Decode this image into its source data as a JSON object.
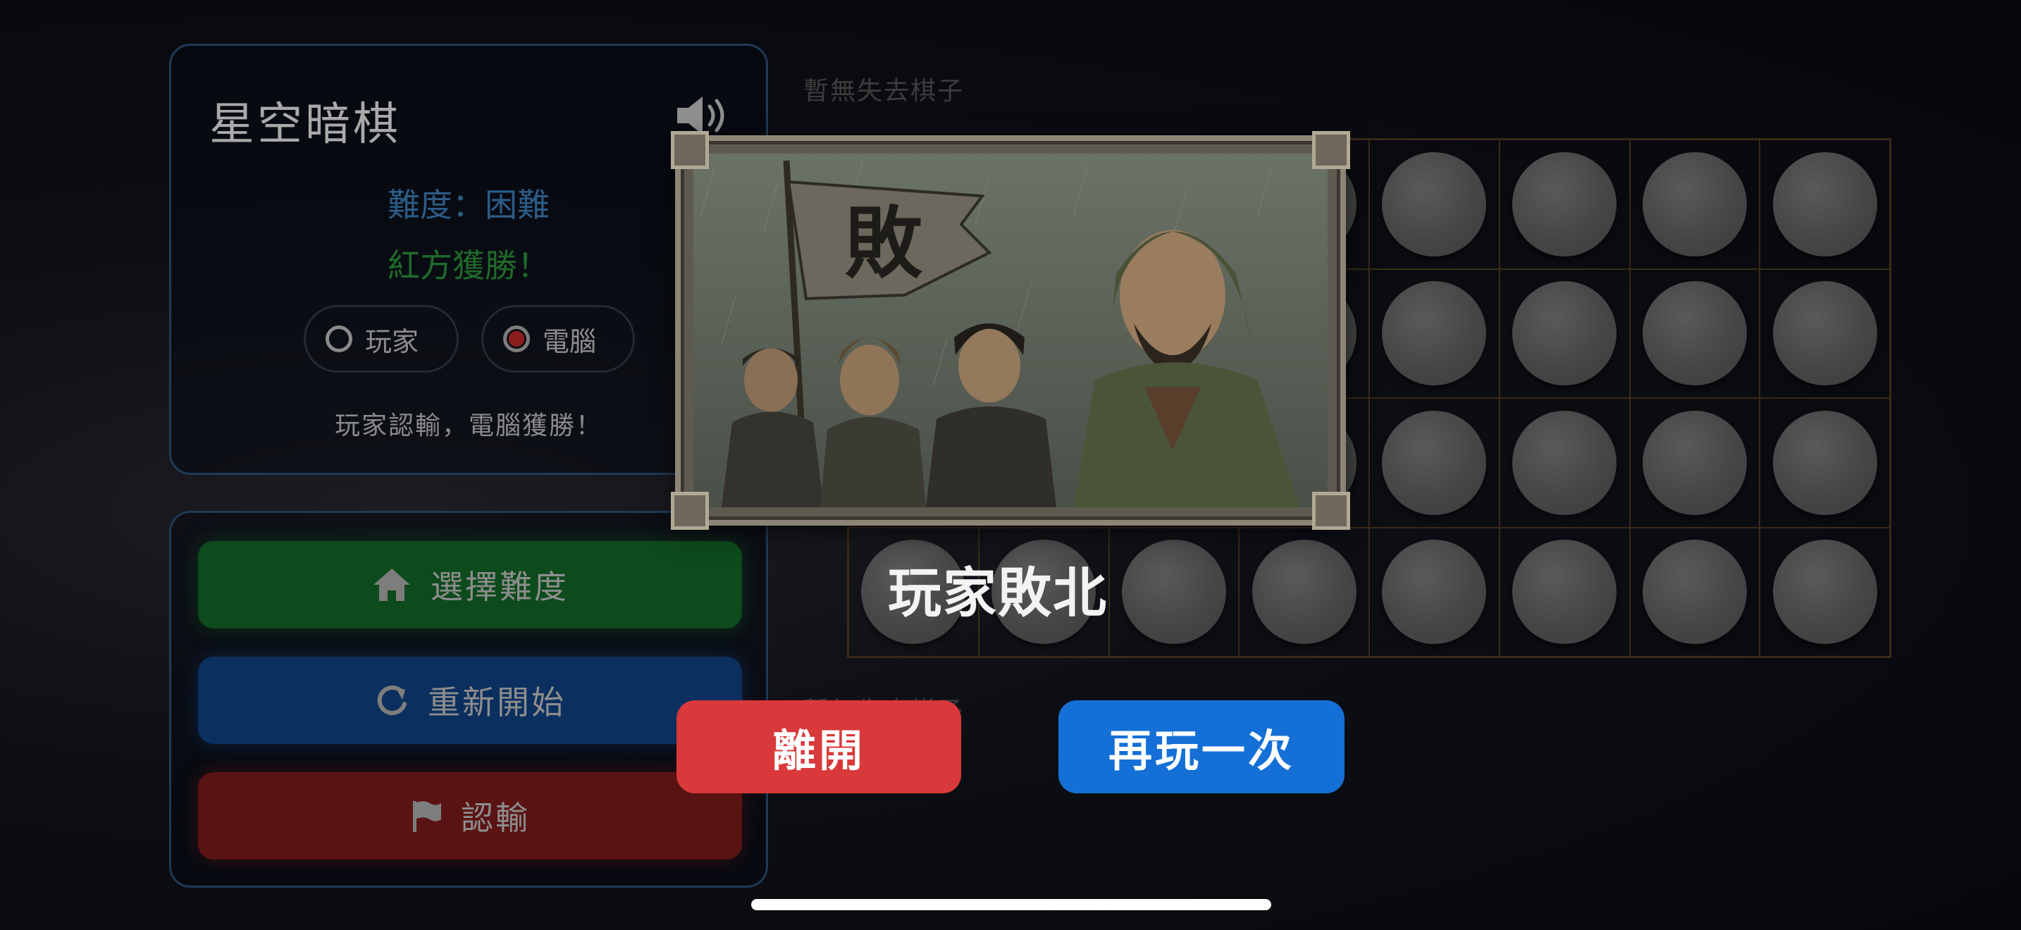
{
  "game": {
    "title": "星空暗棋",
    "difficulty_text": "難度：困難",
    "winner_text": "紅方獲勝！",
    "status_message": "玩家認輸，電腦獲勝！"
  },
  "sides": {
    "player_label": "玩家",
    "computer_label": "電腦",
    "selected": "電腦"
  },
  "menu": {
    "select_difficulty": "選擇難度",
    "restart": "重新開始",
    "resign": "認輸"
  },
  "board": {
    "captured_top": "暫無失去棋子",
    "captured_bottom": "暫無失去棋子",
    "rows": 4,
    "cols": 8,
    "pieces_face_down": 32
  },
  "dialog": {
    "banner_character": "敗",
    "title": "玩家敗北",
    "leave_label": "離開",
    "play_again_label": "再玩一次"
  },
  "colors": {
    "panel_border": "#1f3a56",
    "difficulty_button": "#0d4a1c",
    "restart_button": "#0b2f5e",
    "resign_button": "#5a1313",
    "leave_button": "#d9393a",
    "play_again_button": "#1470d6"
  }
}
